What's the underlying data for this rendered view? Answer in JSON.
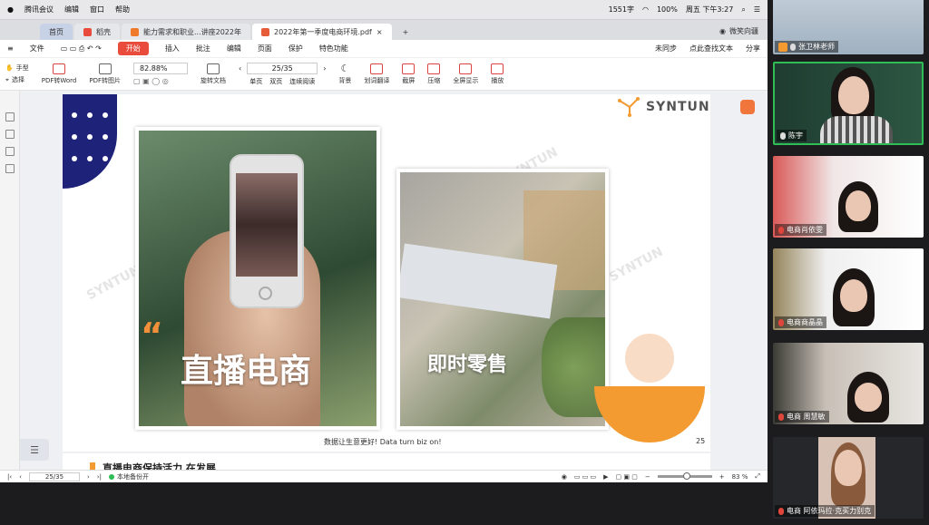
{
  "menubar": {
    "app_name": "腾讯会议",
    "items": [
      "编辑",
      "窗口",
      "帮助"
    ],
    "status": {
      "network": "1551字",
      "battery": "100%",
      "clock": "周五 下午3:27"
    }
  },
  "tabs": {
    "home": "首页",
    "shell": "稻壳",
    "tab1": "能力需求和职业...讲座2022年",
    "tab2": "2022年第一季度电商环境.pdf",
    "add": "+",
    "user": "微笑向疆"
  },
  "ribbon": {
    "file": "文件",
    "start": "开始",
    "items": [
      "插入",
      "批注",
      "编辑",
      "页面",
      "保护",
      "特色功能"
    ],
    "sync": "未同步",
    "search": "点此查找文本",
    "share": "分享"
  },
  "toolbar": {
    "hand": "手型",
    "select": "选择",
    "pdf_word": "PDF转Word",
    "pdf_image": "PDF转图片",
    "zoom": "82.88%",
    "page": "25/35",
    "rotate": "旋转文档",
    "single": "单页",
    "double": "双页",
    "continuous": "连续阅读",
    "background": "背景",
    "translate": "划词翻译",
    "screenshot": "截屏",
    "compress": "压缩",
    "fullscreen": "全屏显示",
    "play": "播放"
  },
  "slide": {
    "logo": "SYNTUN",
    "quote_mark": "“",
    "title_left": "直播电商",
    "title_right": "即时零售",
    "watermark": "SYNTUN",
    "footer": "数据让生意更好! Data turn biz on!",
    "page_number": "25",
    "next_heading": "直播电商保持活力 在发展"
  },
  "statusbar": {
    "page": "25/35",
    "backup": "本地备份开",
    "zoom": "83 %"
  },
  "participants": [
    {
      "name": "张卫林老师",
      "muted": false
    },
    {
      "name": "陈宇",
      "muted": false
    },
    {
      "name": "电商肖依雯",
      "muted": true
    },
    {
      "name": "电商商晶晶",
      "muted": true
    },
    {
      "name": "电商  周慧敏",
      "muted": true
    },
    {
      "name": "电商 阿依玛拉·克买力别克",
      "muted": true
    }
  ],
  "colors": {
    "accent": "#e94b3c",
    "orange": "#f39a30",
    "navy": "#1e2279",
    "active_speaker": "#2fbd56"
  }
}
